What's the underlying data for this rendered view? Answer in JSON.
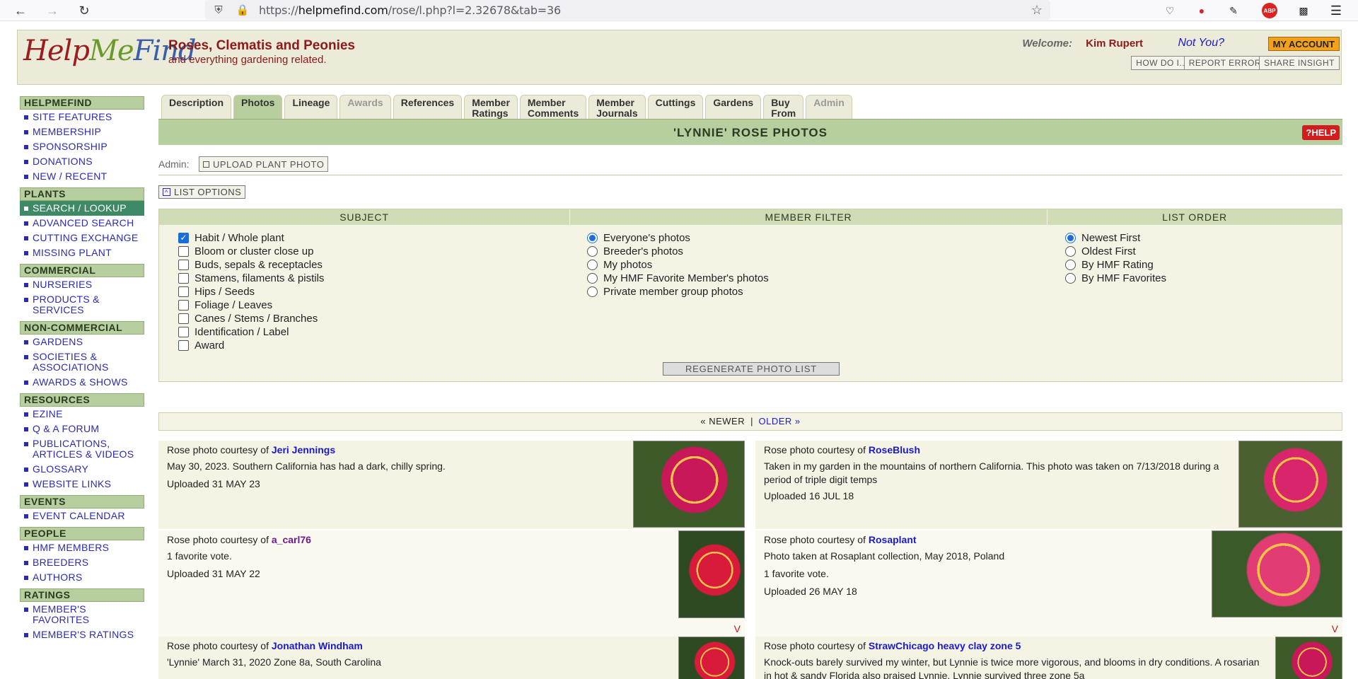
{
  "browser": {
    "url_prefix": "https://",
    "url_host": "helpmefind.com",
    "url_path": "/rose/l.php?l=2.32678&tab=36"
  },
  "header": {
    "logo": {
      "part1": "Help",
      "part2": "Me",
      "part3": "Find"
    },
    "tagline1": "Roses, Clematis and Peonies",
    "tagline2": "and everything gardening related.",
    "welcome": "Welcome:",
    "username": "Kim Rupert",
    "not_you": "Not You?",
    "my_account": "MY ACCOUNT",
    "how_do_i": "HOW DO I...",
    "report_error": "REPORT ERROR",
    "share_insight": "SHARE INSIGHT"
  },
  "sidebar": {
    "sections": [
      {
        "title": "HELPMEFIND",
        "items": [
          "SITE FEATURES",
          "MEMBERSHIP",
          "SPONSORSHIP",
          "DONATIONS",
          "NEW / RECENT"
        ]
      },
      {
        "title": "PLANTS",
        "items": [
          "SEARCH / LOOKUP",
          "ADVANCED SEARCH",
          "CUTTING EXCHANGE",
          "MISSING PLANT"
        ]
      },
      {
        "title": "COMMERCIAL",
        "items": [
          "NURSERIES",
          "PRODUCTS & SERVICES"
        ]
      },
      {
        "title": "NON-COMMERCIAL",
        "items": [
          "GARDENS",
          "SOCIETIES & ASSOCIATIONS",
          "AWARDS & SHOWS"
        ]
      },
      {
        "title": "RESOURCES",
        "items": [
          "EZINE",
          "Q & A FORUM",
          "PUBLICATIONS, ARTICLES & VIDEOS",
          "GLOSSARY",
          "WEBSITE LINKS"
        ]
      },
      {
        "title": "EVENTS",
        "items": [
          "EVENT CALENDAR"
        ]
      },
      {
        "title": "PEOPLE",
        "items": [
          "HMF MEMBERS",
          "BREEDERS",
          "AUTHORS"
        ]
      },
      {
        "title": "RATINGS",
        "items": [
          "MEMBER'S FAVORITES",
          "MEMBER'S RATINGS"
        ]
      }
    ],
    "active_item": "SEARCH / LOOKUP"
  },
  "tabs": [
    {
      "l1": "Description",
      "l2": "",
      "state": "normal"
    },
    {
      "l1": "Photos",
      "l2": "",
      "state": "active"
    },
    {
      "l1": "Lineage",
      "l2": "",
      "state": "normal"
    },
    {
      "l1": "Awards",
      "l2": "",
      "state": "disabled"
    },
    {
      "l1": "References",
      "l2": "",
      "state": "normal"
    },
    {
      "l1": "Member",
      "l2": "Ratings",
      "state": "normal"
    },
    {
      "l1": "Member",
      "l2": "Comments",
      "state": "normal"
    },
    {
      "l1": "Member",
      "l2": "Journals",
      "state": "normal"
    },
    {
      "l1": "Cuttings",
      "l2": "",
      "state": "normal"
    },
    {
      "l1": "Gardens",
      "l2": "",
      "state": "normal"
    },
    {
      "l1": "Buy",
      "l2": "From",
      "state": "normal"
    },
    {
      "l1": "Admin",
      "l2": "",
      "state": "disabled"
    }
  ],
  "title": "'LYNNIE' ROSE PHOTOS",
  "help_label": "?HELP",
  "admin": {
    "label": "Admin:",
    "upload": "UPLOAD PLANT PHOTO"
  },
  "list_options": "LIST OPTIONS",
  "filters": {
    "subject": {
      "title": "SUBJECT",
      "options": [
        {
          "label": "Habit / Whole plant",
          "checked": true
        },
        {
          "label": "Bloom or cluster close up",
          "checked": false
        },
        {
          "label": "Buds, sepals & receptacles",
          "checked": false
        },
        {
          "label": "Stamens, filaments & pistils",
          "checked": false
        },
        {
          "label": "Hips / Seeds",
          "checked": false
        },
        {
          "label": "Foliage / Leaves",
          "checked": false
        },
        {
          "label": "Canes / Stems / Branches",
          "checked": false
        },
        {
          "label": "Identification / Label",
          "checked": false
        },
        {
          "label": "Award",
          "checked": false
        }
      ]
    },
    "member": {
      "title": "MEMBER FILTER",
      "options": [
        {
          "label": "Everyone's photos",
          "checked": true
        },
        {
          "label": "Breeder's photos",
          "checked": false
        },
        {
          "label": "My photos",
          "checked": false
        },
        {
          "label": "My HMF Favorite Member's photos",
          "checked": false
        },
        {
          "label": "Private member group photos",
          "checked": false
        }
      ]
    },
    "order": {
      "title": "LIST ORDER",
      "options": [
        {
          "label": "Newest First",
          "checked": true
        },
        {
          "label": "Oldest First",
          "checked": false
        },
        {
          "label": "By HMF Rating",
          "checked": false
        },
        {
          "label": "By HMF Favorites",
          "checked": false
        }
      ]
    },
    "regenerate": "REGENERATE PHOTO LIST"
  },
  "pager": {
    "newer": "« NEWER",
    "sep": "|",
    "older": "OLDER »"
  },
  "photos": [
    {
      "prefix": "Rose photo courtesy of",
      "author": "Jeri Jennings",
      "caption": "May 30, 2023. Southern California has had a dark, chilly spring.",
      "votes": "",
      "uploaded": "Uploaded 31 MAY 23"
    },
    {
      "prefix": "Rose photo courtesy of",
      "author": "RoseBlush",
      "caption": "Taken in my garden in the mountains of northern California. This photo was taken on 7/13/2018 during a period of triple digit temps",
      "votes": "",
      "uploaded": "Uploaded 16 JUL 18"
    },
    {
      "prefix": "Rose photo courtesy of",
      "author": "a_carl76",
      "caption": "",
      "votes": "1 favorite vote.",
      "uploaded": "Uploaded 31 MAY 22"
    },
    {
      "prefix": "Rose photo courtesy of",
      "author": "Rosaplant",
      "caption": "Photo taken at Rosaplant collection, May 2018, Poland",
      "votes": "1 favorite vote.",
      "uploaded": "Uploaded 26 MAY 18"
    },
    {
      "prefix": "Rose photo courtesy of",
      "author": "Jonathan Windham",
      "caption": "'Lynnie' March 31, 2020 Zone 8a, South Carolina",
      "votes": "",
      "uploaded": ""
    },
    {
      "prefix": "Rose photo courtesy of",
      "author": "StrawChicago heavy clay zone 5",
      "caption": "Knock-outs barely survived my winter, but Lynnie is twice more vigorous, and blooms in dry conditions. A rosarian in hot & sandy Florida also praised Lynnie. Lynnie survived three zone 5a",
      "votes": "",
      "uploaded": ""
    }
  ],
  "vmark": "V"
}
